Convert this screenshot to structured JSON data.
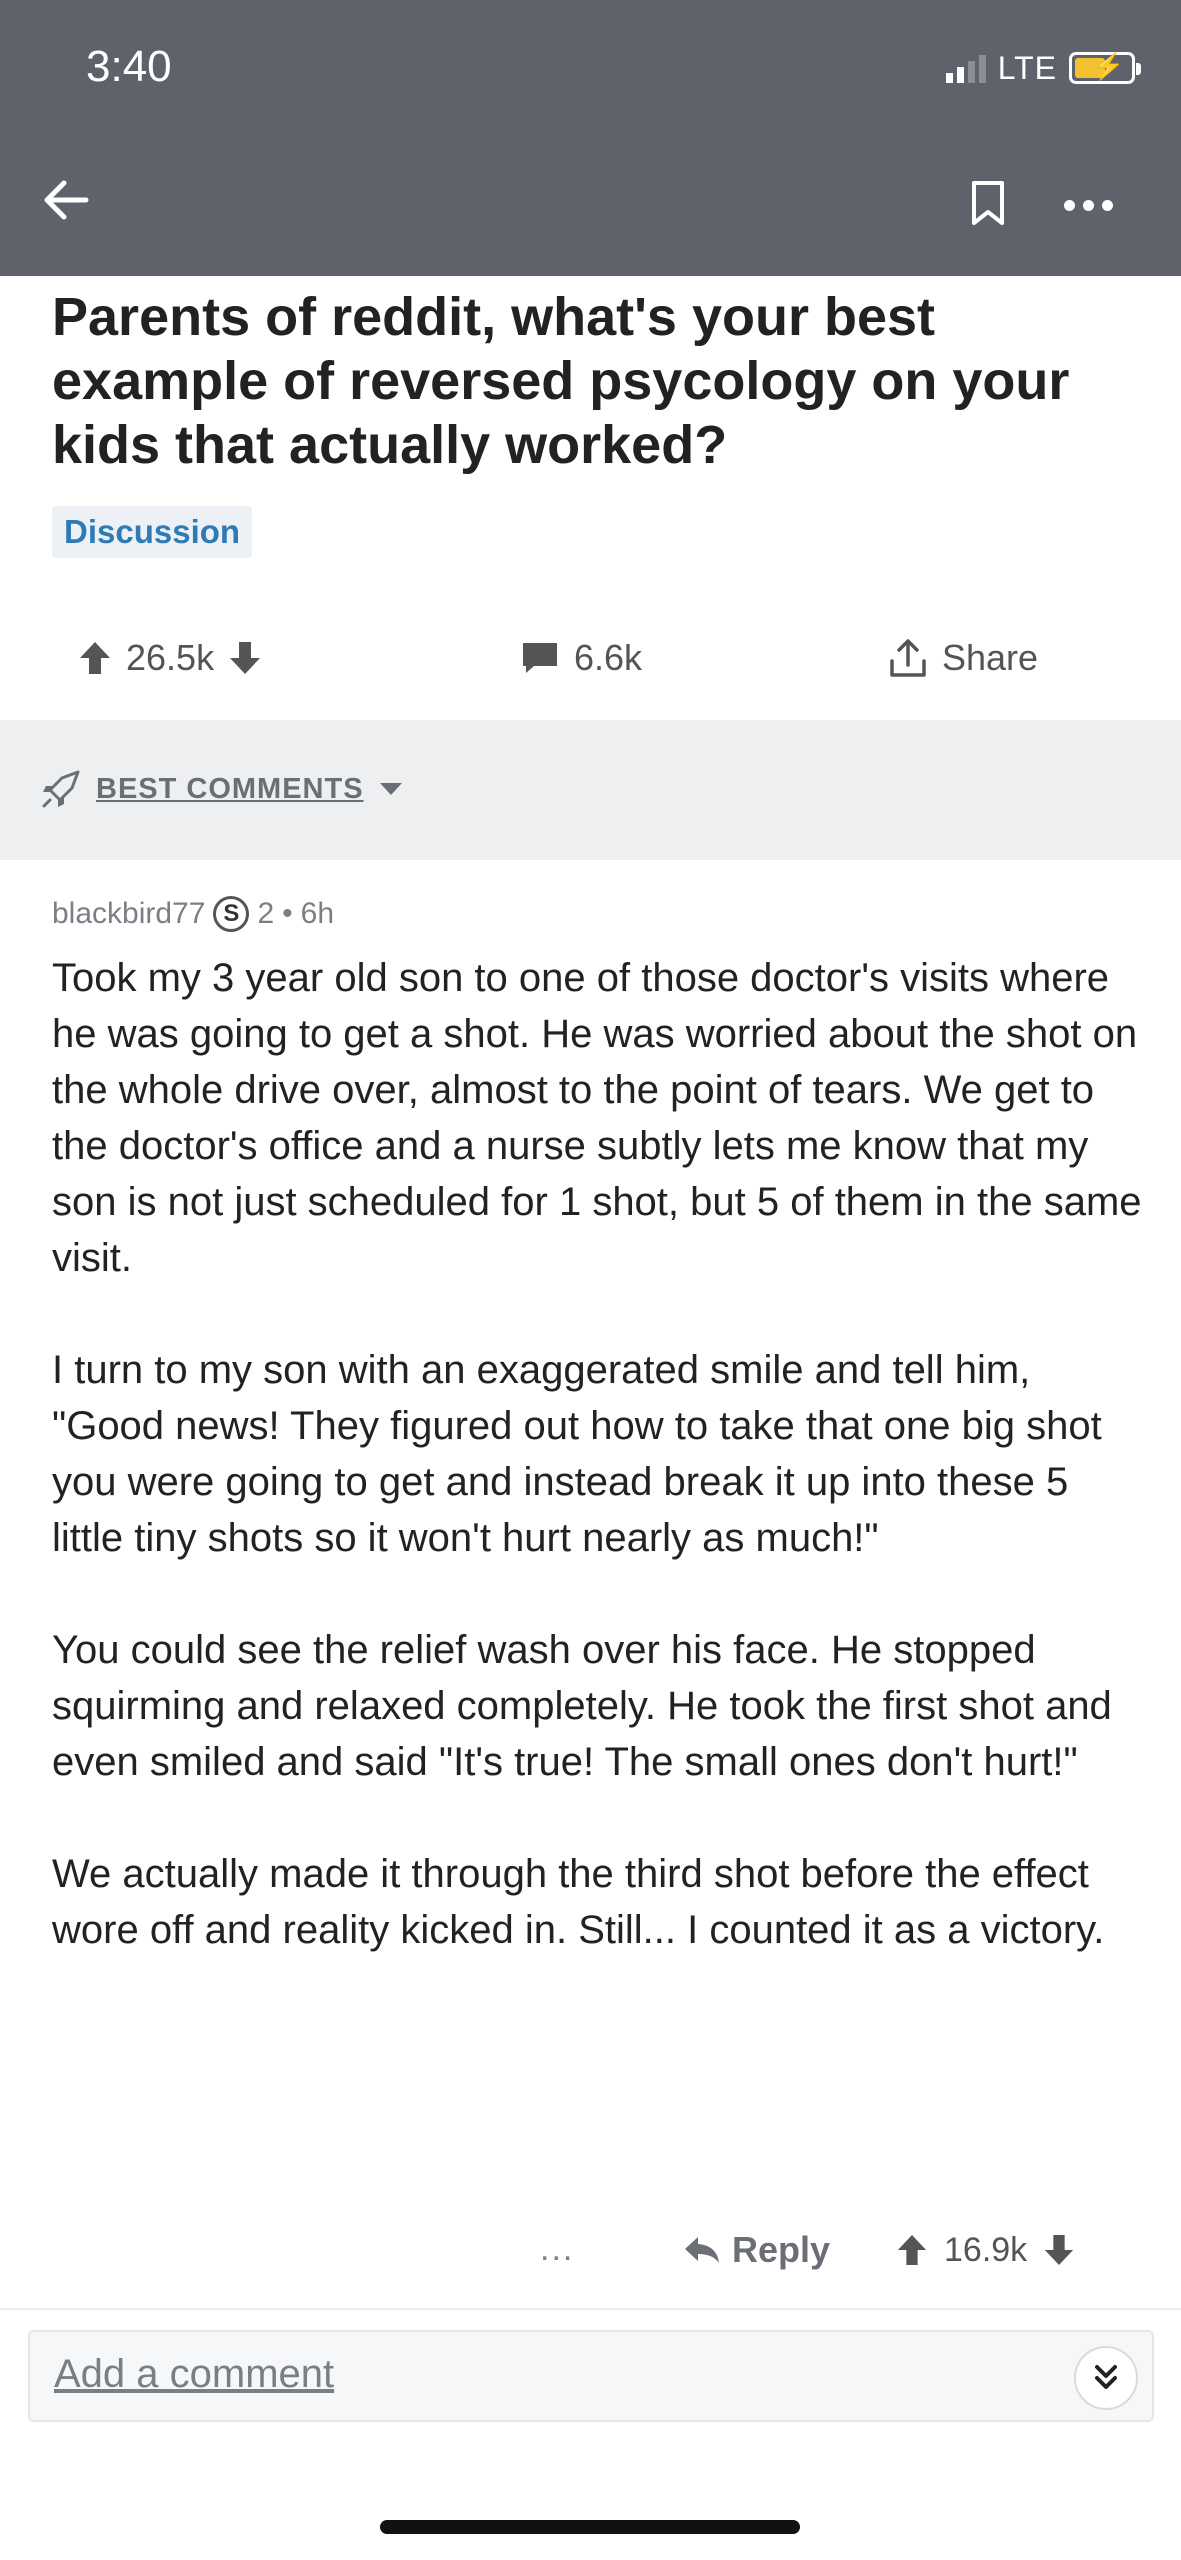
{
  "status_bar": {
    "time": "3:40",
    "network": "LTE"
  },
  "post": {
    "title": "Parents of reddit, what's your best example of reversed psycology on your kids that actually worked?",
    "flair": "Discussion",
    "score": "26.5k",
    "comments": "6.6k",
    "share_label": "Share"
  },
  "sort": {
    "label": "BEST COMMENTS"
  },
  "comment": {
    "author": "blackbird77",
    "karma_badge": "S",
    "karma_level": "2",
    "separator": "•",
    "age": "6h",
    "paragraphs": [
      "Took my 3 year old son to one of those doctor's visits where he was going to get a shot. He was worried about the shot on the whole drive over, almost to the point of tears. We get to the doctor's office and a nurse subtly lets me know that my son is not just scheduled for 1 shot, but 5 of them in the same visit.",
      "I turn to my son with an exaggerated smile and tell him, \"Good news! They figured out how to take that one big shot you were going to get and instead break it up into these 5 little tiny shots so it won't hurt nearly as much!\"",
      "You could see the relief wash over his face. He stopped squirming and relaxed completely. He took the first shot and even smiled and said \"It's true! The small ones don't hurt!\"",
      "We actually made it through the third shot before the effect wore off and reality kicked in. Still... I counted it as a victory."
    ],
    "more_label": "...",
    "reply_label": "Reply",
    "score": "16.9k"
  },
  "composer": {
    "placeholder": "Add a comment"
  },
  "colors": {
    "header_bg": "#5d626b",
    "flair_text": "#2d7cb5",
    "flair_bg": "#edf1f5",
    "sort_bar_bg": "#edeff1"
  },
  "icons": {
    "back": "arrow-left-icon",
    "bookmark": "bookmark-icon",
    "more": "more-dots-icon",
    "upvote": "upvote-arrow-icon",
    "downvote": "downvote-arrow-icon",
    "comments": "comment-bubble-icon",
    "share": "share-icon",
    "sort": "rocket-icon",
    "reply": "reply-icon",
    "expand": "double-chevron-down-icon"
  }
}
